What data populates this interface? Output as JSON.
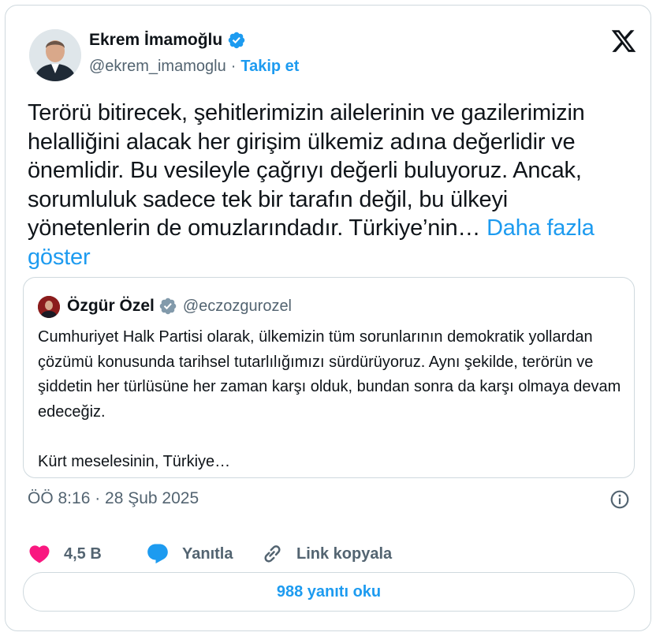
{
  "author": {
    "name": "Ekrem İmamoğlu",
    "handle": "@ekrem_imamoglu",
    "separator": "·",
    "follow_label": "Takip et"
  },
  "tweet": {
    "text": "Terörü bitirecek, şehitlerimizin ailelerinin ve gazilerimizin helalliğini alacak her girişim ülkemiz adına değerlidir ve önemlidir. Bu vesileyle çağrıyı değerli buluyoruz. Ancak, sorumluluk sadece tek bir tarafın değil, bu ülkeyi yönetenlerin de omuzlarındadır. Türkiye’nin…",
    "show_more": "Daha fazla göster"
  },
  "quote": {
    "name": "Özgür Özel",
    "handle": "@eczozgurozel",
    "text": "Cumhuriyet Halk Partisi olarak, ülkemizin tüm sorunlarının demokratik yollardan çözümü konusunda tarihsel tutarlılığımızı sürdürüyoruz. Aynı şekilde, terörün ve şiddetin her türlüsüne her zaman karşı olduk, bundan sonra da karşı olmaya devam edeceğiz.\n\nKürt meselesinin, Türkiye…"
  },
  "timestamp": "ÖÖ 8:16 · 28 Şub 2025",
  "actions": {
    "like_count": "4,5 B",
    "reply_label": "Yanıtla",
    "copy_link_label": "Link kopyala"
  },
  "replies_button": "988 yanıtı oku",
  "icons": {
    "verified": "verified-badge-icon",
    "x_logo": "x-logo-icon",
    "info": "info-icon",
    "like": "heart-icon",
    "reply": "speech-bubble-icon",
    "link": "link-icon"
  },
  "colors": {
    "accent": "#1d9bf0",
    "like": "#f91880",
    "secondary_text": "#536471",
    "border": "#cfd9de"
  }
}
